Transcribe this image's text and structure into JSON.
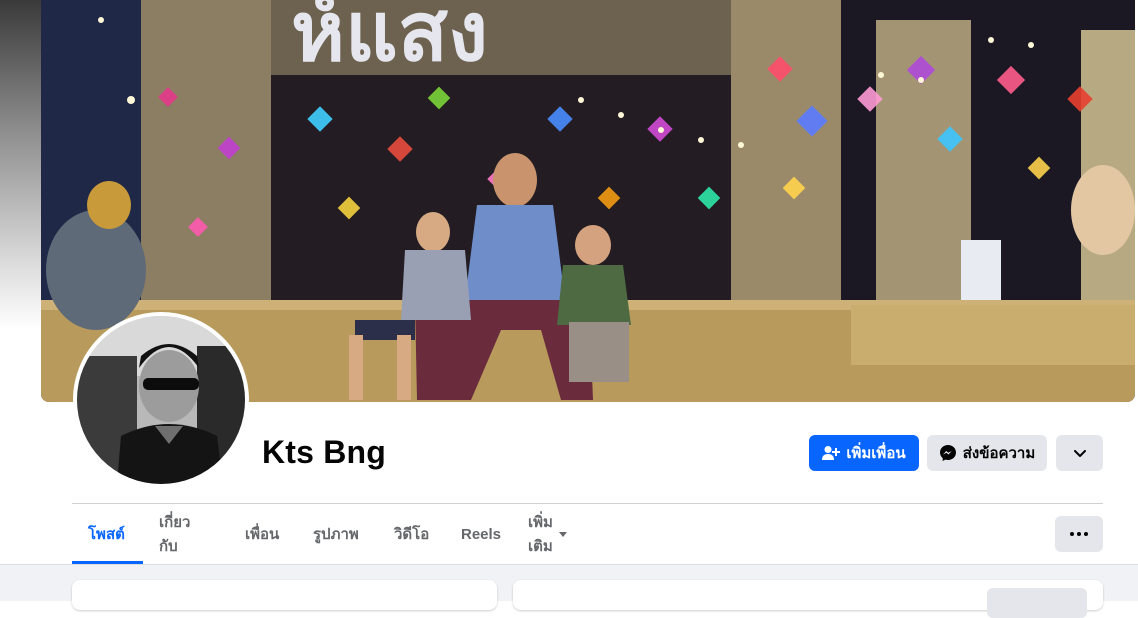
{
  "profile": {
    "name": "Kts Bng"
  },
  "actions": {
    "add_friend_label": "เพิ่มเพื่อน",
    "message_label": "ส่งข้อความ",
    "add_friend_icon": "user-plus-icon",
    "message_icon": "messenger-icon",
    "more_icon": "chevron-down-icon"
  },
  "tabs": [
    {
      "label": "โพสต์",
      "active": true
    },
    {
      "label": "เกี่ยวกับ",
      "active": false
    },
    {
      "label": "เพื่อน",
      "active": false
    },
    {
      "label": "รูปภาพ",
      "active": false
    },
    {
      "label": "วิดีโอ",
      "active": false
    },
    {
      "label": "Reels",
      "active": false
    },
    {
      "label": "เพิ่มเติม",
      "active": false
    }
  ],
  "cover": {
    "sign_text": "ห์แสง"
  },
  "colors": {
    "accent": "#0866ff",
    "secondary_button": "#e4e6eb",
    "feed_background": "#f0f2f5"
  }
}
